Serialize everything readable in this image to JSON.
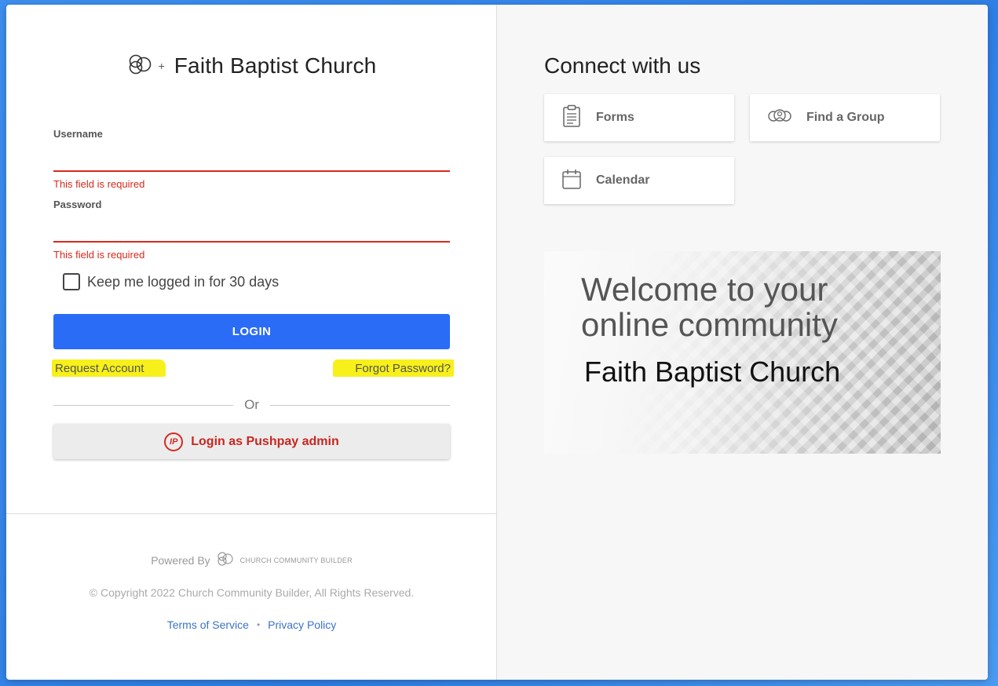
{
  "left": {
    "brand_plus": "+",
    "brand_title": "Faith Baptist Church",
    "username_label": "Username",
    "username_value": "",
    "username_error": "This field is required",
    "password_label": "Password",
    "password_value": "",
    "password_error": "This field is required",
    "keep_logged_label": "Keep me logged in for 30 days",
    "keep_logged_checked": false,
    "login_label": "LOGIN",
    "request_account_label": "Request Account",
    "forgot_password_label": "Forgot Password?",
    "or_label": "Or",
    "pushpay_label": "Login as Pushpay admin",
    "pushpay_icon_text": "IP"
  },
  "footer": {
    "powered_by": "Powered By",
    "ccb_text": "CHURCH COMMUNITY BUILDER",
    "copyright": "© Copyright 2022 Church Community Builder, All Rights Reserved.",
    "terms_label": "Terms of Service",
    "separator": "•",
    "privacy_label": "Privacy Policy"
  },
  "right": {
    "connect_title": "Connect with us",
    "tiles": [
      {
        "label": "Forms",
        "icon": "clipboard-icon"
      },
      {
        "label": "Find a Group",
        "icon": "group-icon"
      },
      {
        "label": "Calendar",
        "icon": "calendar-icon"
      }
    ],
    "banner_line1": "Welcome to your",
    "banner_line2": "online community",
    "banner_church": "Faith Baptist Church"
  },
  "colors": {
    "primary_button": "#2a6cf6",
    "error": "#d9291c",
    "highlight": "#f7f01a",
    "pushpay_red": "#c8261f",
    "link_blue": "#3b73c4"
  }
}
